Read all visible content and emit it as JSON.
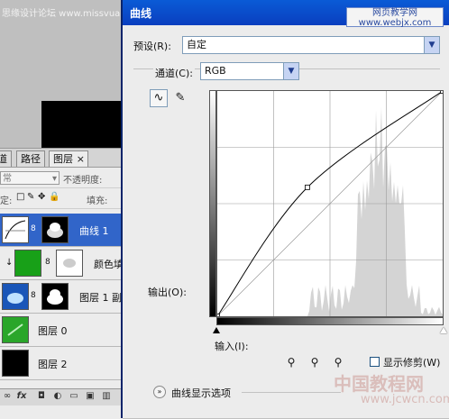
{
  "background": {
    "watermark_text": "思缘设计论坛 www.missvuan.com"
  },
  "layers_panel": {
    "tabs": [
      "道",
      "路径",
      "图层"
    ],
    "active_tab_close": "×",
    "blend_mode": "常",
    "opacity_label": "不透明度:",
    "lock_label": "定:",
    "fill_label": "填充:",
    "layers": [
      {
        "name": "曲线 1",
        "selected": true
      },
      {
        "name": "颜色填",
        "selected": false
      },
      {
        "name": "图层 1 副",
        "selected": false
      },
      {
        "name": "图层 0",
        "selected": false
      },
      {
        "name": "图层 2",
        "selected": false
      }
    ],
    "footer_icons": [
      "link-icon",
      "fx-icon",
      "mask-icon",
      "adjustment-icon",
      "folder-icon",
      "new-layer-icon",
      "trash-icon"
    ],
    "fx_label": "fx"
  },
  "dialog": {
    "title": "曲线",
    "watermark": "网页教学网\nwww.webjx.com",
    "preset_label": "预设(R):",
    "preset_value": "自定",
    "channel_label": "通道(C):",
    "channel_value": "RGB",
    "output_label": "输出(O):",
    "input_label": "输入(I):",
    "show_clipping_label": "显示修剪(W)",
    "curve_display_options_label": "曲线显示选项",
    "bottom_watermark": "中国教程网",
    "bottom_watermark_url": "www.jcwcn.com",
    "accent_color": "#0a46c8",
    "selected_layer_color": "#3165c9"
  },
  "chart_data": {
    "type": "line",
    "title": "",
    "xlabel": "",
    "ylabel": "",
    "xlim": [
      0,
      255
    ],
    "ylim": [
      0,
      255
    ],
    "grid": true,
    "series": [
      {
        "name": "",
        "x": [
          0,
          102,
          255
        ],
        "y": [
          0,
          146,
          255
        ]
      }
    ],
    "reference_diagonal": true,
    "histogram_peak_location": "right of center"
  }
}
